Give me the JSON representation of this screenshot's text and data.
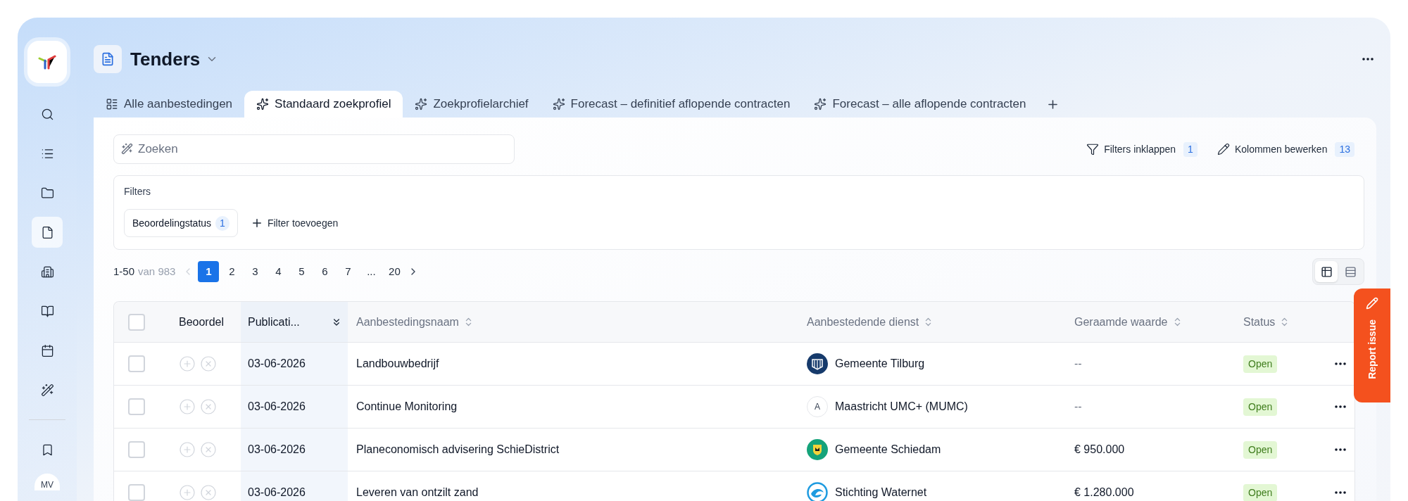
{
  "sidebar": {
    "items": [
      {
        "kind": "search",
        "selected": false
      },
      {
        "kind": "list",
        "selected": false
      },
      {
        "kind": "folder",
        "selected": false
      },
      {
        "kind": "file",
        "selected": true
      },
      {
        "kind": "building",
        "selected": false
      },
      {
        "kind": "book",
        "selected": false
      },
      {
        "kind": "calendar",
        "selected": false
      },
      {
        "kind": "wand",
        "selected": false
      }
    ],
    "bottom_items": [
      {
        "kind": "bookmark",
        "selected": false
      }
    ],
    "avatar": "MV"
  },
  "header": {
    "title": "Tenders"
  },
  "tabs": [
    {
      "label": "Alle aanbestedingen",
      "kind": "list",
      "selected": false
    },
    {
      "label": "Standaard zoekprofiel",
      "kind": "sparkles",
      "selected": true
    },
    {
      "label": "Zoekprofielarchief",
      "kind": "sparkles",
      "selected": false
    },
    {
      "label": "Forecast – definitief aflopende contracten",
      "kind": "sparkles",
      "selected": false
    },
    {
      "label": "Forecast – alle aflopende contracten",
      "kind": "sparkles",
      "selected": false
    }
  ],
  "search": {
    "placeholder": "Zoeken"
  },
  "toolbar": [
    {
      "label": "Filters inklappen",
      "count": "1",
      "kind": "filter"
    },
    {
      "label": "Kolommen bewerken",
      "count": "13",
      "kind": "pencil"
    }
  ],
  "filters": {
    "title": "Filters",
    "chips": [
      {
        "label": "Beoordelingstatus",
        "count": "1"
      }
    ],
    "add": "Filter toevoegen"
  },
  "pagination": {
    "range": "1-50",
    "of": "van 983",
    "pages": [
      {
        "label": "1",
        "selected": true
      },
      {
        "label": "2",
        "selected": false
      },
      {
        "label": "3",
        "selected": false
      },
      {
        "label": "4",
        "selected": false
      },
      {
        "label": "5",
        "selected": false
      },
      {
        "label": "6",
        "selected": false
      },
      {
        "label": "7",
        "selected": false
      },
      {
        "label": "...",
        "selected": false
      },
      {
        "label": "20",
        "selected": false
      }
    ]
  },
  "view_toggle": [
    {
      "kind": "table",
      "selected": true
    },
    {
      "kind": "rows",
      "selected": false
    }
  ],
  "table": {
    "select_all": {
      "checked": false
    },
    "columns": [
      {
        "label": "Beoordel",
        "sortable": false,
        "sorted": false
      },
      {
        "label": "Publicati...",
        "sortable": true,
        "sorted": true
      },
      {
        "label": "Aanbestedingsnaam",
        "sortable": true,
        "sorted": false
      },
      {
        "label": "Aanbestedende dienst",
        "sortable": true,
        "sorted": false
      },
      {
        "label": "Geraamde waarde",
        "sortable": true,
        "sorted": false
      },
      {
        "label": "Status",
        "sortable": true,
        "sorted": false
      }
    ],
    "rows": [
      {
        "checked": false,
        "date": "03-06-2026",
        "name": "Landbouwbedrijf",
        "org": "Gemeente Tilburg",
        "org_logo": {
          "kind": "crest"
        },
        "value": "--",
        "status": "Open"
      },
      {
        "checked": false,
        "date": "03-06-2026",
        "name": "Continue Monitoring",
        "org": "Maastricht UMC+ (MUMC)",
        "org_logo": {
          "kind": "letter",
          "letter": "A"
        },
        "value": "--",
        "status": "Open"
      },
      {
        "checked": false,
        "date": "03-06-2026",
        "name": "Planeconomisch advisering SchieDistrict",
        "org": "Gemeente Schiedam",
        "org_logo": {
          "kind": "shield"
        },
        "value": "€ 950.000",
        "status": "Open"
      },
      {
        "checked": false,
        "date": "03-06-2026",
        "name": "Leveren van ontzilt zand",
        "org": "Stichting Waternet",
        "org_logo": {
          "kind": "wave"
        },
        "value": "€ 1.280.000",
        "status": "Open"
      }
    ]
  },
  "report_issue": {
    "label": "Report issue"
  }
}
